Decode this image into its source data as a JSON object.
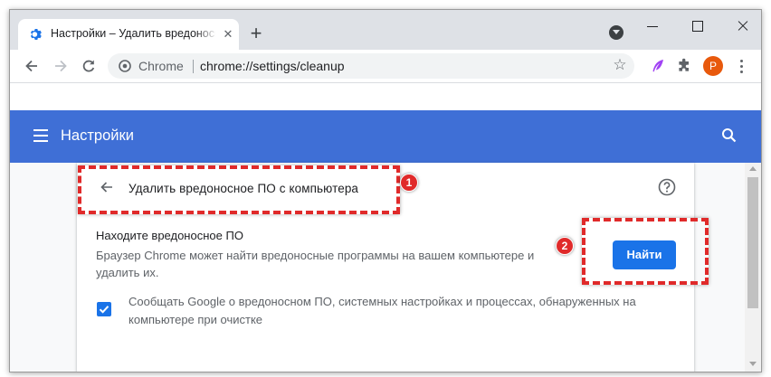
{
  "tab": {
    "title": "Настройки – Удалить вредоносное ПО",
    "icon": "gear-icon",
    "close_icon": "close-icon"
  },
  "new_tab_label": "+",
  "toolbar": {
    "back_icon": "back-arrow-icon",
    "forward_icon": "forward-arrow-icon",
    "reload_icon": "reload-icon",
    "omnibox_site": "Chrome",
    "omnibox_url": "chrome://settings/cleanup",
    "bookmark_icon": "star-icon",
    "avatar_letter": "P"
  },
  "settings": {
    "header_title": "Настройки",
    "page_heading": "Удалить вредоносное ПО с компьютера",
    "section_title": "Находите вредоносное ПО",
    "section_description": "Браузер Chrome может найти вредоносные программы на вашем компьютере и удалить их.",
    "find_button": "Найти",
    "checkbox_checked": true,
    "checkbox_label": "Сообщать Google о вредоносном ПО, системных настройках и процессах, обнаруженных на компьютере при очистке"
  },
  "annotations": {
    "marker_1": "1",
    "marker_2": "2"
  },
  "colors": {
    "header_blue": "#3f6fd6",
    "button_blue": "#1a73e8",
    "annotation_red": "#e02a2a",
    "avatar_orange": "#e8590c"
  }
}
